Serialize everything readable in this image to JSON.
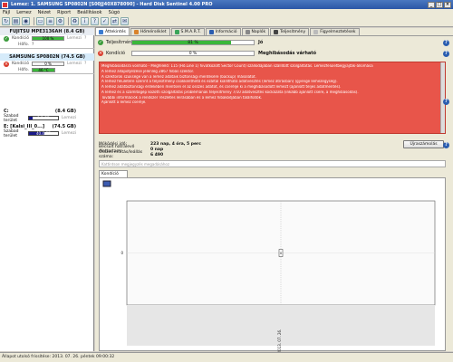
{
  "window": {
    "title": "Lemez: 1. SAMSUNG SP0802N [S00JJ40X878090] - Hard Disk Sentinel 4.00 PRO"
  },
  "menu": [
    "Fájl",
    "Lemez",
    "Nézet",
    "Riport",
    "Beállítások",
    "Súgó"
  ],
  "toolbar_icons": [
    "refresh-icon",
    "save-icon",
    "disk-icon",
    "drive-icon",
    "report-icon",
    "options-icon",
    "recycle-icon",
    "info-icon",
    "help-icon",
    "test-icon",
    "link-icon",
    "email-icon"
  ],
  "left": {
    "disk1": {
      "name": "FUJITSU MPE3136AH",
      "size": "(8.4 GB)",
      "condition_label": "Kondíció",
      "condition_value": "100 %",
      "condition_pct": 100,
      "temp_label": "Hőfo.",
      "temp_value": "?",
      "measure": "Lemezi",
      "measure2": "?"
    },
    "disk2": {
      "name": "SAMSUNG SP0802N",
      "size": "(74.5 GB)",
      "condition_label": "Kondíció",
      "condition_value": "0 %",
      "condition_pct": 0,
      "temp_label": "Hőfo.",
      "temp_value": "46 °C",
      "measure": "Lemezi",
      "measure2": "?"
    },
    "vol1": {
      "name": "C:",
      "size": "(8.4 GB)",
      "free_label": "Szabad terület",
      "free_value": "1.2 GB",
      "free_pct": 14,
      "measure": "Lemezi"
    },
    "vol2": {
      "name": "E: [Kalsi_III_0...]",
      "size": "(74.5 GB)",
      "free_label": "Szabad terület",
      "free_value": "40.4 GB",
      "free_pct": 54,
      "measure": "Lemezi"
    }
  },
  "tabs": [
    "Áttekintés",
    "Hőmérséklet",
    "S.M.A.R.T.",
    "Információ",
    "Naplók",
    "Teljesítmény",
    "Figyelmeztetések"
  ],
  "main": {
    "perf_label": "Teljesítmény",
    "perf_value": "81 %",
    "perf_pct": 81,
    "perf_status": "Jó",
    "cond_label": "Kondíció",
    "cond_value": "0 %",
    "cond_pct": 0,
    "cond_status": "Meghibásodás várható",
    "warning_lines": [
      "Meghibásodásra vonható - Megfelelő: 115 (Hő.Line 1) hivatkozott Sector Count) szállodájában szállított szolgáltatás. Lemezfelületbegyajták-állomása",
      "A lemez állapotjelzése jelenleg 2867 hibás szektor.",
      "A szektorok szüksége van a lemez adataik biztonsági mentésére (backup) másolatot.",
      "A lemez felületére szerint a teljesítmény csökkenthető és ezáltal kiállítható adatvesztés (lemez átírásban) (gyenge lemezegység).",
      "A lemez adatbiztonsági érdekében mentsen el az összes adatot, és cserélje ki a meghibásodott lemezt (ajánlott teljes adatmentés).",
      "A lemez és a számítógép közötti szolgáltatás problémának teljesítmény 7/10 adatvesztés kockázata (inkább ajánlott csere, a meghibásodás).",
      "További információk a rendszer részletes leírásában és a lemez hibakódjában találhatók.",
      "Ajánlott a lemez cseréje."
    ],
    "stats": [
      {
        "k": "Működési idő:",
        "v": "223 nap, 4 óra, 5 perc"
      },
      {
        "k": "Becsült hátralevő élettartam:",
        "v": "0 nap"
      },
      {
        "k": "Összes indítás/leállás száma:",
        "v": "6 490"
      }
    ],
    "update_button": "Újraszámolás",
    "note_placeholder": "Kattintson megjegyzés megadásához",
    "chart_tab": "Kondíció (%)"
  },
  "chart_data": {
    "type": "line",
    "x": [
      "2013. 07. 26."
    ],
    "series": [
      {
        "values": [
          0
        ]
      }
    ],
    "ylabel": "",
    "xlabel": "",
    "ylim": [
      0,
      100
    ],
    "ytick_labels": [
      "0"
    ],
    "data_labels": [
      "0"
    ],
    "grid": true
  },
  "status": {
    "text": "Állapot utolsó frissítése: 2013. 07. 26. péntek 09:00:32"
  },
  "colors": {
    "good": "#3ab73a",
    "bad": "#e8554a",
    "volume_bar": "#1a1a8a"
  }
}
